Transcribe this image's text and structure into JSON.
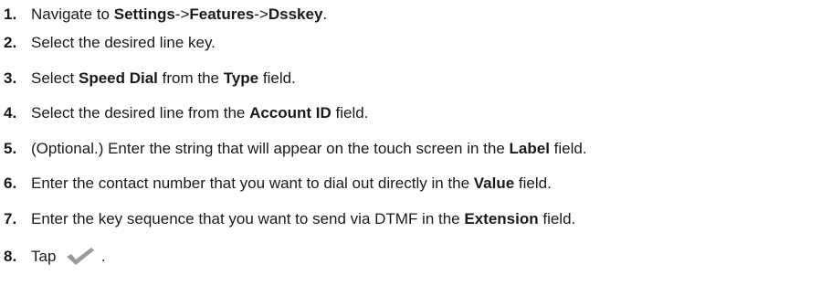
{
  "steps": [
    {
      "number": "1.",
      "parts": [
        {
          "t": "Navigate to "
        },
        {
          "t": "Settings",
          "b": true
        },
        {
          "t": "->"
        },
        {
          "t": "Features",
          "b": true
        },
        {
          "t": "->"
        },
        {
          "t": "Dsskey",
          "b": true
        },
        {
          "t": "."
        }
      ]
    },
    {
      "number": "2.",
      "parts": [
        {
          "t": "Select the desired line key."
        }
      ]
    },
    {
      "number": "3.",
      "parts": [
        {
          "t": "Select "
        },
        {
          "t": "Speed Dial",
          "b": true
        },
        {
          "t": " from the "
        },
        {
          "t": "Type",
          "b": true
        },
        {
          "t": " field."
        }
      ]
    },
    {
      "number": "4.",
      "parts": [
        {
          "t": "Select the desired line from the "
        },
        {
          "t": "Account ID",
          "b": true
        },
        {
          "t": " field."
        }
      ]
    },
    {
      "number": "5.",
      "parts": [
        {
          "t": "(Optional.) Enter the string that will appear on the touch screen in the "
        },
        {
          "t": "Label",
          "b": true
        },
        {
          "t": " field."
        }
      ]
    },
    {
      "number": "6.",
      "parts": [
        {
          "t": "Enter the contact number that you want to dial out directly in the "
        },
        {
          "t": "Value",
          "b": true
        },
        {
          "t": " field."
        }
      ]
    },
    {
      "number": "7.",
      "parts": [
        {
          "t": "Enter the key sequence that you want to send via DTMF in the "
        },
        {
          "t": "Extension",
          "b": true
        },
        {
          "t": " field."
        }
      ]
    },
    {
      "number": "8.",
      "parts": [
        {
          "t": "Tap "
        },
        {
          "icon": "check-icon"
        },
        {
          "t": " ."
        }
      ]
    }
  ],
  "colors": {
    "text": "#1a1a1a",
    "check_icon": "#9a9a9a"
  }
}
